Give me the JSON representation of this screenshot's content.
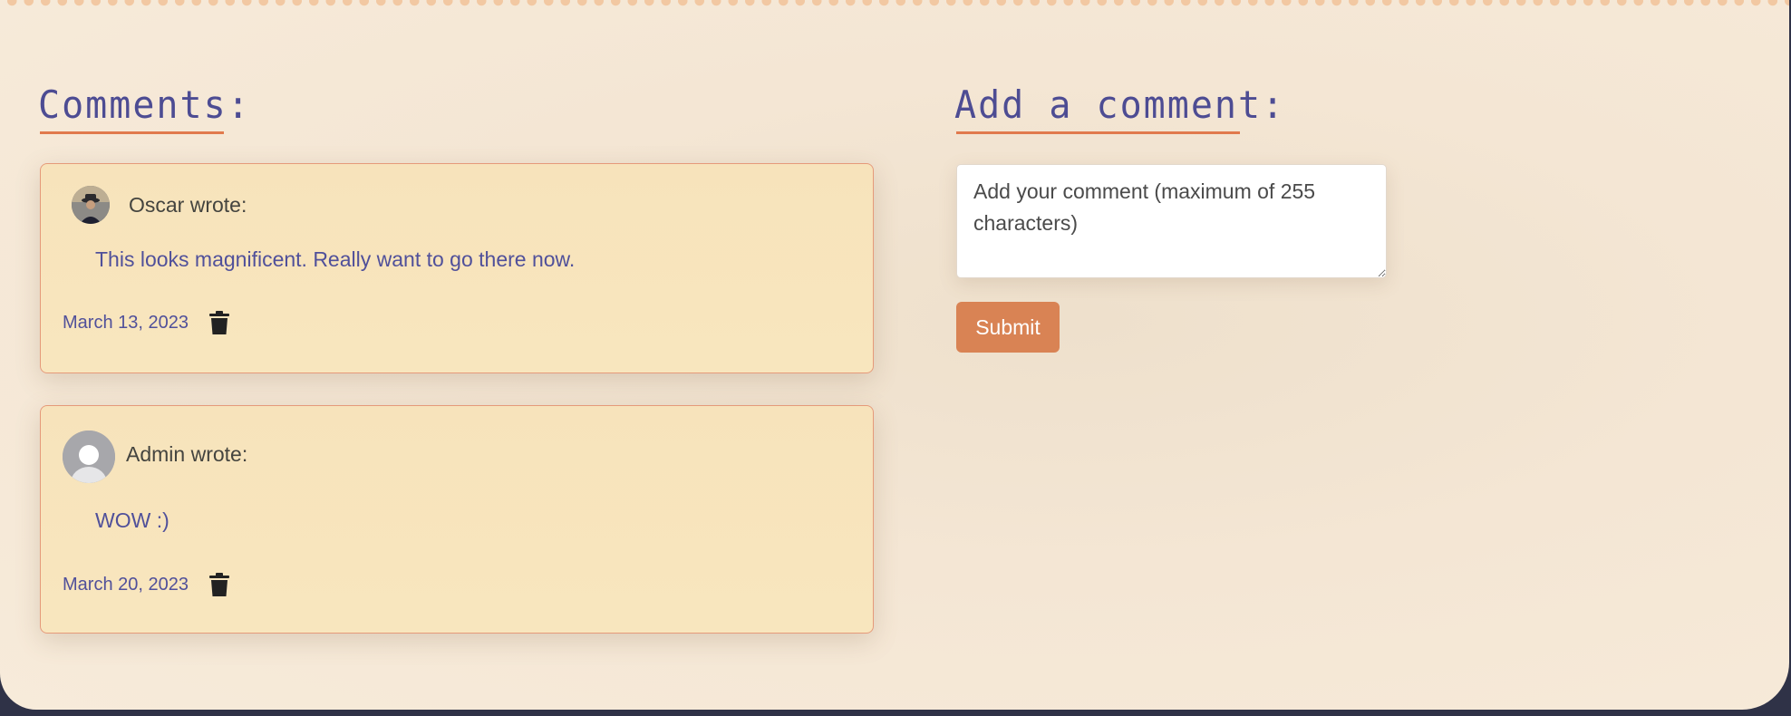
{
  "comments_section": {
    "title": "Comments:",
    "items": [
      {
        "author": "Oscar wrote:",
        "text": "This looks magnificent. Really want to go there now.",
        "date": "March 13, 2023",
        "avatar": "user-photo-avatar",
        "delete_icon": "trash-icon"
      },
      {
        "author": "Admin wrote:",
        "text": "WOW :)",
        "date": "March 20, 2023",
        "avatar": "default-user-avatar",
        "delete_icon": "trash-icon"
      }
    ]
  },
  "add_comment": {
    "title": "Add a comment:",
    "placeholder": "Add your comment (maximum of 255 characters)",
    "submit_label": "Submit"
  },
  "colors": {
    "accent": "#e17a4d",
    "heading": "#4d4c93",
    "card_bg": "#f8e6be",
    "button": "#d98354",
    "outer_bg": "#2f3247"
  }
}
